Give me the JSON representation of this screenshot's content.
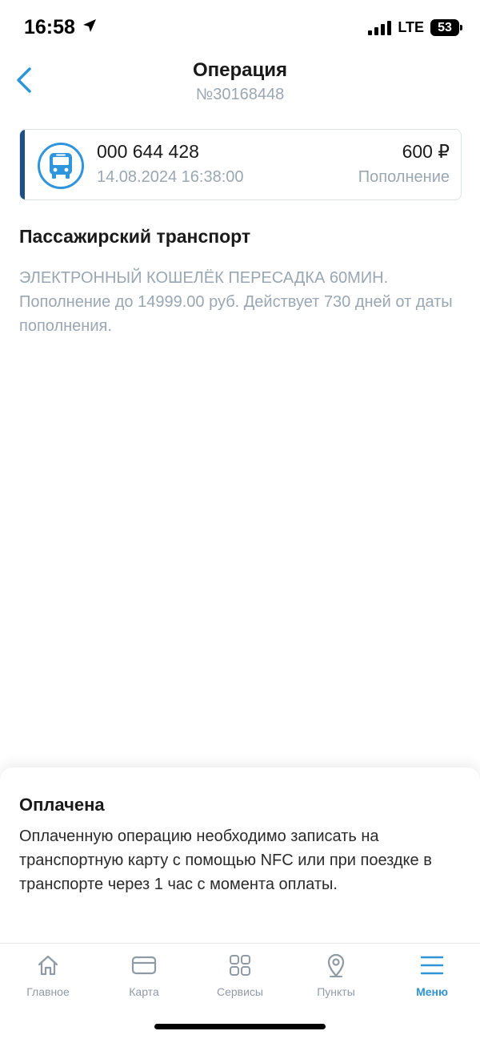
{
  "status": {
    "time": "16:58",
    "network": "LTE",
    "battery": "53"
  },
  "header": {
    "title": "Операция",
    "subtitle": "№30168448"
  },
  "operation": {
    "card_number": "000 644 428",
    "datetime": "14.08.2024 16:38:00",
    "amount": "600 ₽",
    "type": "Пополнение",
    "icon": "bus-icon",
    "accent_color": "#1d5082",
    "icon_color": "#2e94dc"
  },
  "details": {
    "title": "Пассажирский транспорт",
    "description": "ЭЛЕКТРОННЫЙ КОШЕЛЁК ПЕРЕСАДКА 60МИН. Пополнение до 14999.00 руб. Действует 730 дней от даты пополнения."
  },
  "notice": {
    "title": "Оплачена",
    "text": "Оплаченную операцию необходимо записать на транспортную карту с помощью NFC или при поездке в транспорте через 1 час с момента оплаты."
  },
  "tabs": [
    {
      "label": "Главное",
      "icon": "home-icon",
      "active": false
    },
    {
      "label": "Карта",
      "icon": "card-icon",
      "active": false
    },
    {
      "label": "Сервисы",
      "icon": "services-icon",
      "active": false
    },
    {
      "label": "Пункты",
      "icon": "location-pin-icon",
      "active": false
    },
    {
      "label": "Меню",
      "icon": "menu-icon",
      "active": true
    }
  ],
  "colors": {
    "active_tab": "#2e94dc",
    "inactive_tab": "#8f9aa5",
    "muted_text": "#9aa7b3"
  }
}
